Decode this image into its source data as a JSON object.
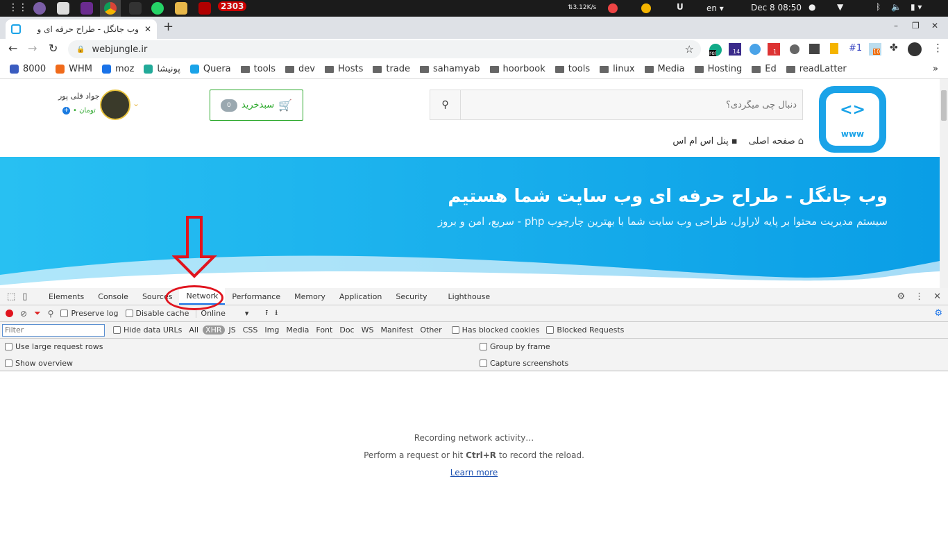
{
  "os": {
    "badge": "2303",
    "net_speed": "⇅3.12K/s",
    "lang": "en ▾",
    "datetime": "Dec 8  08:50"
  },
  "browser": {
    "tab_title": "وب جانگل - طراح حرفه ای و",
    "url": "webjungle.ir",
    "bookmarks": [
      "8000",
      "WHM",
      "moz",
      "پونیشا",
      "Quera",
      "tools",
      "dev",
      "Hosts",
      "trade",
      "sahamyab",
      "hoorbook",
      "tools",
      "linux",
      "Media",
      "Hosting",
      "Ed",
      "readLatter"
    ],
    "bookmark_folders": [
      false,
      false,
      false,
      false,
      false,
      true,
      true,
      true,
      true,
      true,
      true,
      true,
      true,
      true,
      true,
      true,
      true
    ],
    "ext_badges": {
      "rel": "rel",
      "b14": "14",
      "b1": "1",
      "hash": "#1",
      "b10": "10"
    },
    "more": "»"
  },
  "site": {
    "user_name": "جواد قلی پور",
    "balance": "• تومان",
    "cart_label": "سبدخرید",
    "cart_count": "0",
    "search_placeholder": "دنبال چی میگردی؟",
    "nav": [
      "صفحه اصلی",
      "پنل اس ام اس"
    ],
    "logo_text": "www",
    "hero_title": "وب جانگل - طراح حرفه ای وب سایت شما هستیم",
    "hero_subtitle": "سیستم مدیریت محتوا بر پایه لاراول، طراحی وب سایت شما با بهترین چارچوب php - سریع، امن و بروز",
    "colors": {
      "accent": "#0aa0e8",
      "cart": "#2aa82a",
      "annotation": "#e0141e"
    }
  },
  "devtools": {
    "tabs": [
      "Elements",
      "Console",
      "Sources",
      "Network",
      "Performance",
      "Memory",
      "Application",
      "Security",
      "Lighthouse"
    ],
    "active_tab": "Network",
    "preserve_log": "Preserve log",
    "disable_cache": "Disable cache",
    "throttle": "Online",
    "filter_placeholder": "Filter",
    "hide_data_urls": "Hide data URLs",
    "types": [
      "All",
      "XHR",
      "JS",
      "CSS",
      "Img",
      "Media",
      "Font",
      "Doc",
      "WS",
      "Manifest",
      "Other"
    ],
    "active_type": "XHR",
    "has_blocked": "Has blocked cookies",
    "blocked_requests": "Blocked Requests",
    "large_rows": "Use large request rows",
    "show_overview": "Show overview",
    "group_by_frame": "Group by frame",
    "capture_screenshots": "Capture screenshots",
    "msg1": "Recording network activity…",
    "msg2a": "Perform a request or hit ",
    "msg2b": "Ctrl+R",
    "msg2c": " to record the reload.",
    "learn_more": "Learn more"
  }
}
